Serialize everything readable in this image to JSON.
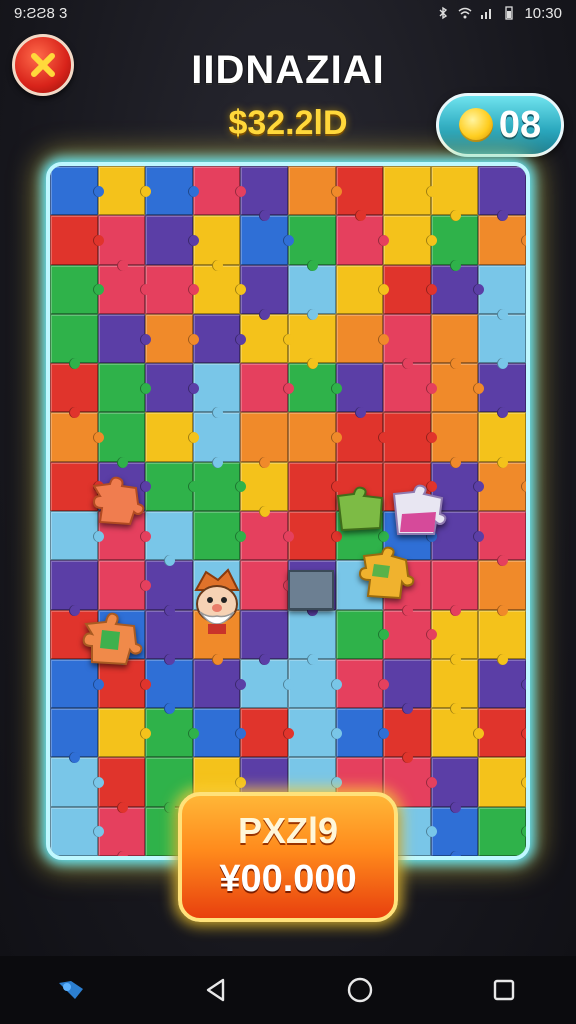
{
  "status_bar": {
    "left_text": "9:ƧƧ8 3",
    "time": "10:30"
  },
  "header": {
    "title": "IIDNAZIAI",
    "score": "$32.2lD"
  },
  "coins": {
    "count": "08",
    "accent": "#2aa7bd"
  },
  "prize": {
    "label": "PXZl9",
    "value": "¥00.000"
  },
  "board": {
    "palette": [
      "#e0342c",
      "#f4c21b",
      "#2fb24a",
      "#5b3ea6",
      "#2f6fd6",
      "#79c6e8",
      "#f08a2a",
      "#e5405e"
    ]
  },
  "icons": {
    "close": "close-x-icon",
    "coin": "gold-coin-icon",
    "nav": [
      "back-triangle-icon",
      "home-circle-icon",
      "recents-square-icon",
      "assistant-icon"
    ]
  }
}
